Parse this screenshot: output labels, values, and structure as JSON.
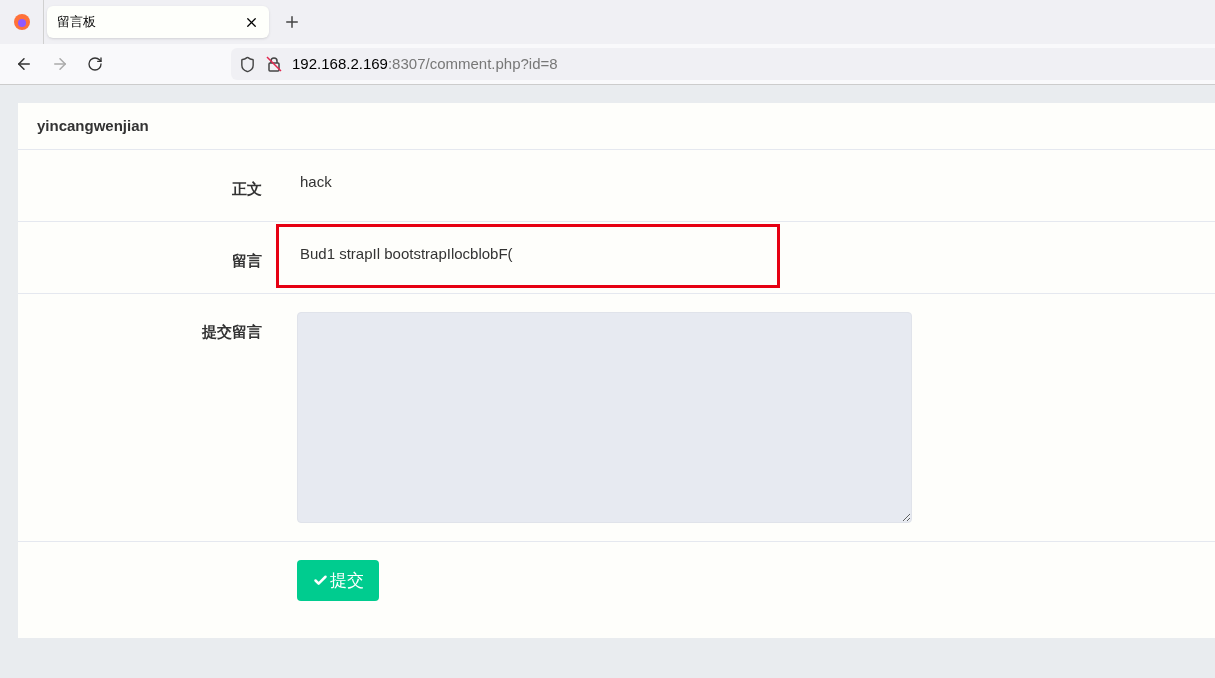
{
  "browser": {
    "tab": {
      "title": "留言板",
      "selected": true
    },
    "url": {
      "host": "192.168.2.169",
      "rest": ":8307/comment.php?id=8"
    }
  },
  "card": {
    "title": "yincangwenjian",
    "rows": [
      {
        "label": "正文",
        "value": "hack",
        "highlighted": false
      },
      {
        "label": "留言",
        "value": "Bud1 strapIl bootstrapIlocblobF(",
        "highlighted": true
      }
    ],
    "form": {
      "label": "提交留言",
      "button": "提交"
    }
  }
}
